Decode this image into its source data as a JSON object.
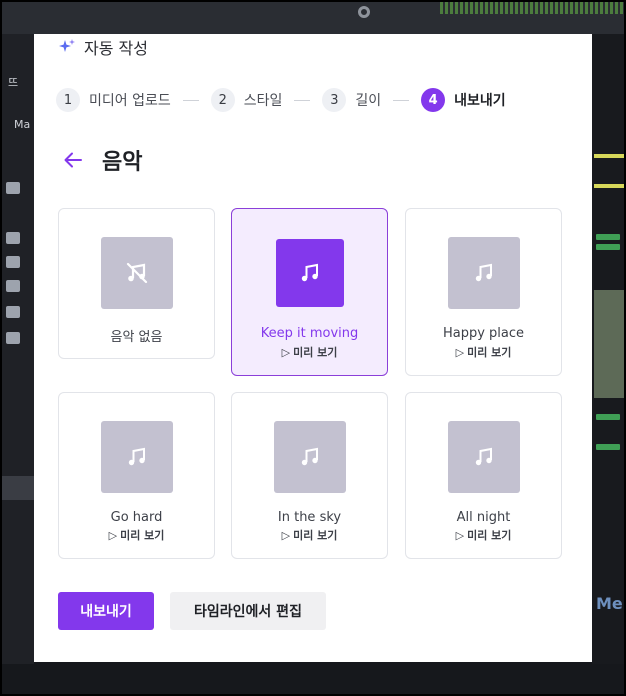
{
  "dialog": {
    "title": "자동 작성",
    "accent_color": "#8338ec"
  },
  "stepper": {
    "steps": [
      {
        "number": "1",
        "label": "미디어 업로드",
        "active": false
      },
      {
        "number": "2",
        "label": "스타일",
        "active": false
      },
      {
        "number": "3",
        "label": "길이",
        "active": false
      },
      {
        "number": "4",
        "label": "내보내기",
        "active": true
      }
    ]
  },
  "section": {
    "title": "음악",
    "back_icon": "arrow-left-icon"
  },
  "music_options": [
    {
      "title": "음악 없음",
      "preview": "",
      "icon": "music-off-icon",
      "selected": false
    },
    {
      "title": "Keep it moving",
      "preview": "미리 보기",
      "icon": "music-note-icon",
      "selected": true
    },
    {
      "title": "Happy place",
      "preview": "미리 보기",
      "icon": "music-note-icon",
      "selected": false
    },
    {
      "title": "Go hard",
      "preview": "미리 보기",
      "icon": "music-note-icon",
      "selected": false
    },
    {
      "title": "In the sky",
      "preview": "미리 보기",
      "icon": "music-note-icon",
      "selected": false
    },
    {
      "title": "All night",
      "preview": "미리 보기",
      "icon": "music-note-icon",
      "selected": false
    }
  ],
  "footer": {
    "export_label": "내보내기",
    "edit_timeline_label": "타임라인에서 편집"
  },
  "background": {
    "left_labels": [
      "Ma",
      "뜨"
    ],
    "right_badge": "Me"
  }
}
